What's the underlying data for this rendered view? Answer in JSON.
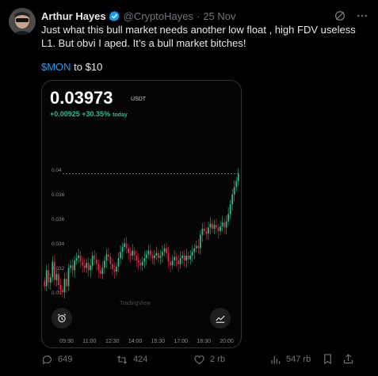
{
  "tweet": {
    "author_name": "Arthur Hayes",
    "handle": "@CryptoHayes",
    "date": "25 Nov",
    "text": "Just what this bull market needs another low float , high FDV useless L1. But obvi I aped. It’s a bull market bitches!",
    "cashtag": "$MON",
    "line2_rest": " to $10"
  },
  "card": {
    "price": "0.03973",
    "unit": "USDT",
    "change": "+0.00925 +30.35%",
    "change_suffix": "today",
    "watermark": "TradingView"
  },
  "actions": {
    "replies": "649",
    "reposts": "424",
    "likes": "2 rb",
    "views": "547 rb"
  },
  "colors": {
    "up": "#2ebd85",
    "down": "#e0294a",
    "link": "#1d9bf0"
  },
  "chart_data": {
    "type": "candlestick",
    "x_ticks": [
      "09:30",
      "11:00",
      "12:30",
      "14:00",
      "15:30",
      "17:00",
      "18:30",
      "20:00"
    ],
    "y_ticks": [
      "0.04",
      "0.038",
      "0.036",
      "0.034",
      "0.032",
      "0.03"
    ],
    "ylim": [
      0.0295,
      0.0405
    ],
    "current_line": 0.0397,
    "close_series": [
      0.0305,
      0.0318,
      0.0308,
      0.0312,
      0.0325,
      0.031,
      0.0315,
      0.0306,
      0.0302,
      0.03,
      0.0311,
      0.0305,
      0.032,
      0.0322,
      0.0318,
      0.0326,
      0.0328,
      0.033,
      0.0325,
      0.0322,
      0.032,
      0.0324,
      0.0318,
      0.0322,
      0.033,
      0.0327,
      0.0323,
      0.0318,
      0.0315,
      0.032,
      0.0326,
      0.0331,
      0.0329,
      0.0323,
      0.0319,
      0.0317,
      0.0321,
      0.0328,
      0.0333,
      0.0337,
      0.034,
      0.0336,
      0.0332,
      0.033,
      0.0334,
      0.033,
      0.0326,
      0.0324,
      0.0322,
      0.0325,
      0.0328,
      0.0331,
      0.0334,
      0.033,
      0.0328,
      0.033,
      0.0332,
      0.0328,
      0.033,
      0.0333,
      0.0336,
      0.0332,
      0.0325,
      0.0322,
      0.0326,
      0.0329,
      0.0326,
      0.0323,
      0.0328,
      0.033,
      0.0326,
      0.033,
      0.0327,
      0.033,
      0.0333,
      0.0336,
      0.0338,
      0.0336,
      0.0347,
      0.0352,
      0.035,
      0.0348,
      0.0353,
      0.0356,
      0.0352,
      0.0355,
      0.0353,
      0.035,
      0.0354,
      0.0357,
      0.0353,
      0.0358,
      0.0364,
      0.0372,
      0.038,
      0.0386,
      0.0391,
      0.0397
    ]
  }
}
